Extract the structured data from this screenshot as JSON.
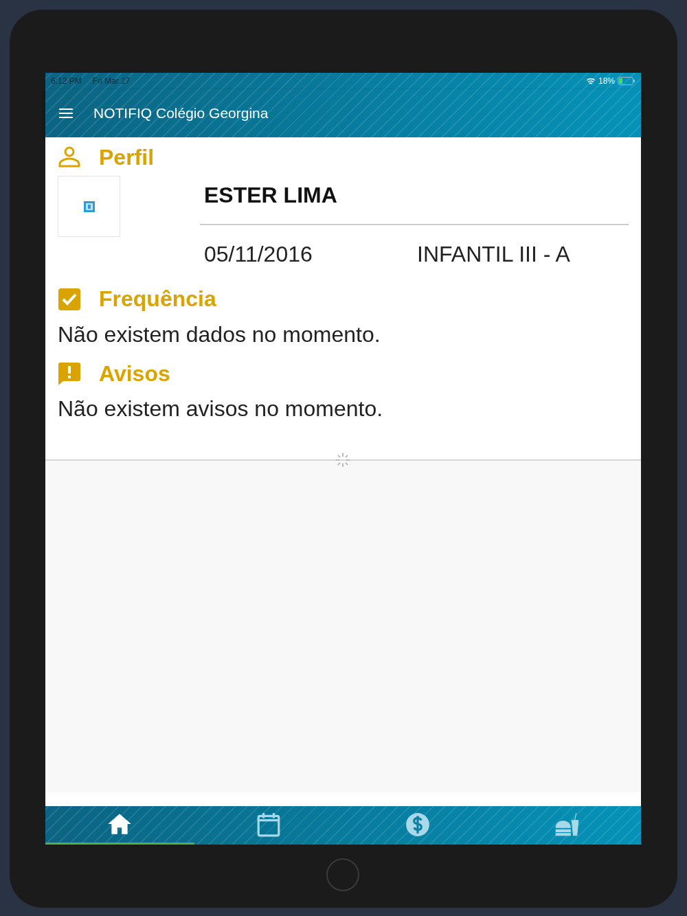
{
  "status_bar": {
    "time": "6:12 PM",
    "date": "Fri Mar 27",
    "battery": "18%"
  },
  "app_bar": {
    "title": "NOTIFIQ Colégio Georgina"
  },
  "profile": {
    "title": "Perfil",
    "name": "ESTER LIMA",
    "birth_date": "05/11/2016",
    "class": "INFANTIL III - A"
  },
  "sections": [
    {
      "kind": "check",
      "title": "Frequência",
      "message": "Não existem dados no momento."
    },
    {
      "kind": "alert",
      "title": "Avisos",
      "message": "Não existem avisos no momento."
    }
  ],
  "tabs": [
    {
      "kind": "home",
      "selected": true
    },
    {
      "kind": "calendar",
      "selected": false
    },
    {
      "kind": "money",
      "selected": false
    },
    {
      "kind": "food",
      "selected": false
    }
  ]
}
